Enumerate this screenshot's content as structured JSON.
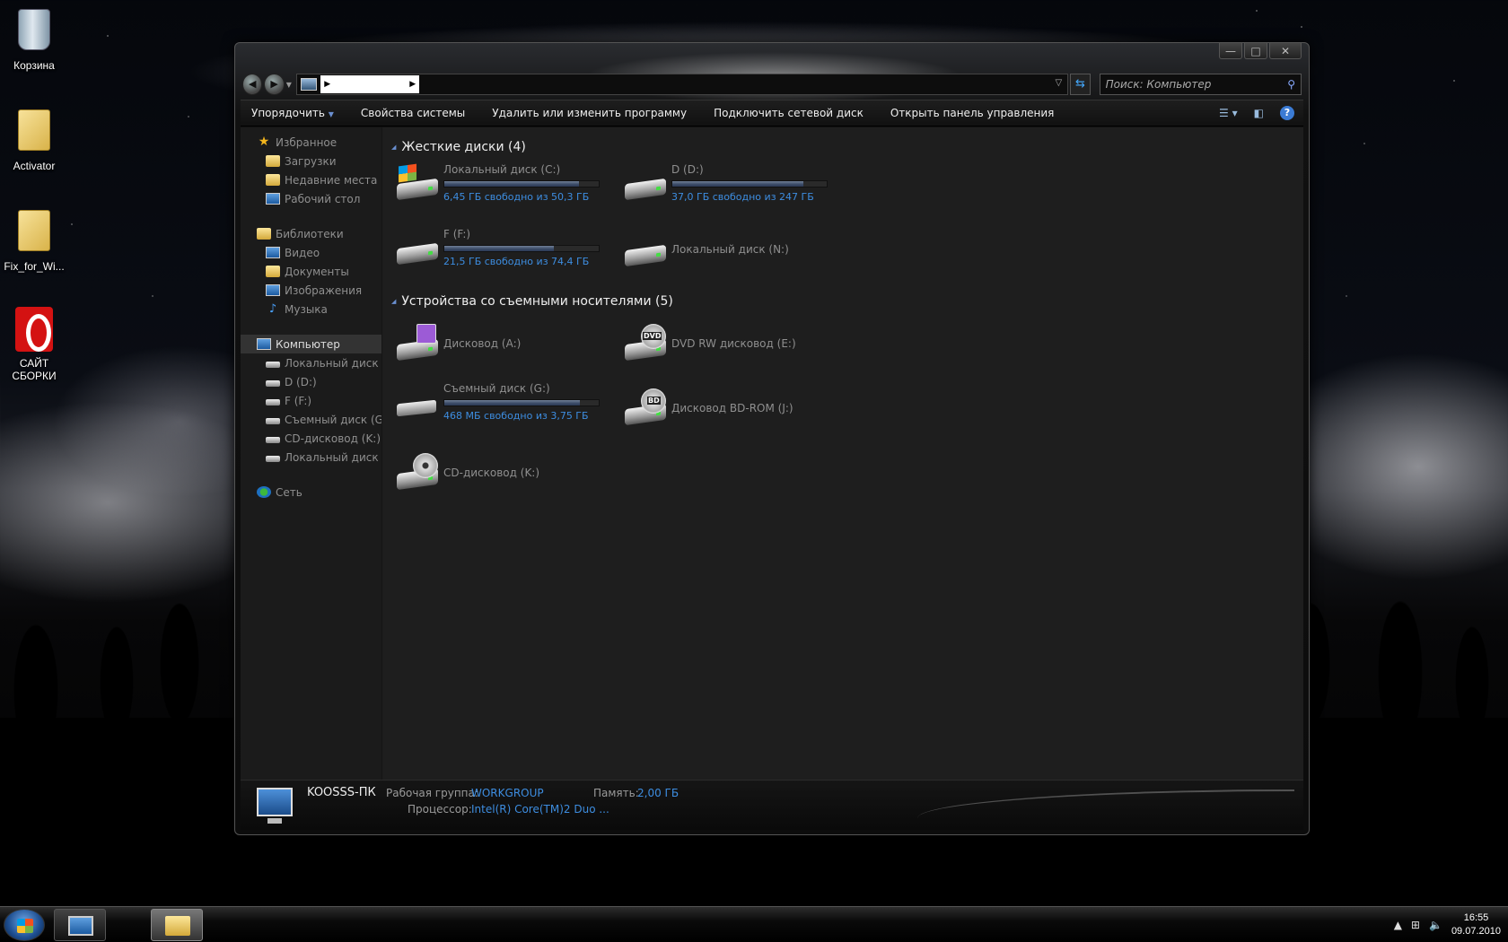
{
  "desktop": {
    "icons": [
      {
        "label": "Корзина"
      },
      {
        "label": "Activator"
      },
      {
        "label": "Fix_for_Wi..."
      },
      {
        "label": "САЙТ СБОРКИ"
      }
    ]
  },
  "window": {
    "caption_buttons": {
      "minimize": "—",
      "maximize": "□",
      "close": "✕"
    },
    "search_placeholder": "Поиск: Компьютер"
  },
  "toolbar": {
    "organize": "Упорядочить",
    "system_properties": "Свойства системы",
    "uninstall": "Удалить или изменить программу",
    "map_drive": "Подключить сетевой диск",
    "control_panel": "Открыть панель управления"
  },
  "navpane": {
    "favorites": {
      "label": "Избранное",
      "items": [
        "Загрузки",
        "Недавние места",
        "Рабочий стол"
      ]
    },
    "libraries": {
      "label": "Библиотеки",
      "items": [
        "Видео",
        "Документы",
        "Изображения",
        "Музыка"
      ]
    },
    "computer": {
      "label": "Компьютер",
      "items": [
        "Локальный диск (C",
        "D (D:)",
        "F (F:)",
        "Съемный диск (G:)",
        "CD-дисковод (K:)",
        "Локальный диск (N"
      ]
    },
    "network": {
      "label": "Сеть"
    }
  },
  "sections": {
    "hdd": {
      "title": "Жесткие диски (4)",
      "drives": [
        {
          "name": "Локальный диск (C:)",
          "free": "6,45 ГБ свободно из 50,3 ГБ",
          "used_fraction": 0.87
        },
        {
          "name": "D (D:)",
          "free": "37,0 ГБ свободно из 247 ГБ",
          "used_fraction": 0.85
        },
        {
          "name": "F (F:)",
          "free": "21,5 ГБ свободно из 74,4 ГБ",
          "used_fraction": 0.71
        },
        {
          "name": "Локальный диск (N:)"
        }
      ]
    },
    "removable": {
      "title": "Устройства со съемными носителями (5)",
      "drives": [
        {
          "name": "Дисковод (A:)"
        },
        {
          "name": "DVD RW дисковод (E:)",
          "badge": "DVD"
        },
        {
          "name": "Съемный диск (G:)",
          "free": "468 МБ свободно из 3,75 ГБ",
          "used_fraction": 0.88
        },
        {
          "name": "Дисковод BD-ROM (J:)",
          "badge": "BD"
        },
        {
          "name": "CD-дисковод (K:)"
        }
      ]
    }
  },
  "details": {
    "pc_name": "KOOSSS-ПК",
    "workgroup_label": "Рабочая группа:",
    "workgroup_value": "WORKGROUP",
    "memory_label": "Память:",
    "memory_value": "2,00 ГБ",
    "cpu_label": "Процессор:",
    "cpu_value": "Intel(R) Core(TM)2 Duo ..."
  },
  "taskbar": {
    "time": "16:55",
    "date": "09.07.2010"
  }
}
